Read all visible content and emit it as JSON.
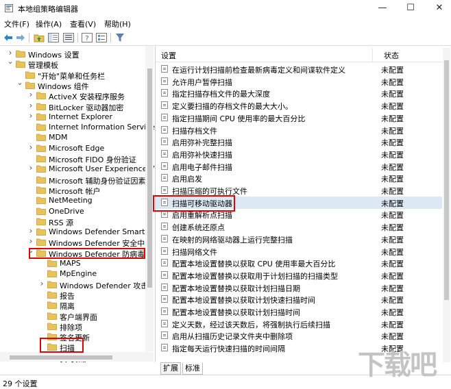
{
  "window": {
    "title": "本地组策略编辑器",
    "controls": [
      "—",
      "☐",
      "✕"
    ]
  },
  "menu": [
    "文件(F)",
    "操作(A)",
    "查看(V)",
    "帮助(H)"
  ],
  "tree": [
    {
      "label": "Windows 设置",
      "arrow": ">",
      "indent": 0
    },
    {
      "label": "管理模板",
      "arrow": "v",
      "indent": 0
    },
    {
      "label": "\"开始\"菜单和任务栏",
      "arrow": "",
      "indent": 1
    },
    {
      "label": "Windows 组件",
      "arrow": "v",
      "indent": 1
    },
    {
      "label": "ActiveX 安装程序服务",
      "arrow": ">",
      "indent": 2
    },
    {
      "label": "BitLocker 驱动器加密",
      "arrow": ">",
      "indent": 2
    },
    {
      "label": "Internet Explorer",
      "arrow": ">",
      "indent": 2
    },
    {
      "label": "Internet Information Service",
      "arrow": "",
      "indent": 2
    },
    {
      "label": "MDM",
      "arrow": "",
      "indent": 2
    },
    {
      "label": "Microsoft Edge",
      "arrow": ">",
      "indent": 2
    },
    {
      "label": "Microsoft FIDO 身份验证",
      "arrow": "",
      "indent": 2
    },
    {
      "label": "Microsoft User Experience V",
      "arrow": ">",
      "indent": 2
    },
    {
      "label": "Microsoft 辅助身份验证因素",
      "arrow": "",
      "indent": 2
    },
    {
      "label": "Microsoft 帐户",
      "arrow": "",
      "indent": 2
    },
    {
      "label": "NetMeeting",
      "arrow": "",
      "indent": 2
    },
    {
      "label": "OneDrive",
      "arrow": "",
      "indent": 2
    },
    {
      "label": "RSS 源",
      "arrow": "",
      "indent": 2
    },
    {
      "label": "Windows Defender SmartSc",
      "arrow": ">",
      "indent": 2
    },
    {
      "label": "Windows Defender 安全中心",
      "arrow": ">",
      "indent": 2
    },
    {
      "label": "Windows Defender 防病毒程",
      "arrow": "v",
      "indent": 2
    },
    {
      "label": "MAPS",
      "arrow": "",
      "indent": 3
    },
    {
      "label": "MpEngine",
      "arrow": "",
      "indent": 3
    },
    {
      "label": "Windows Defender 攻击",
      "arrow": ">",
      "indent": 3
    },
    {
      "label": "报告",
      "arrow": "",
      "indent": 3
    },
    {
      "label": "隔离",
      "arrow": "",
      "indent": 3
    },
    {
      "label": "客户端界面",
      "arrow": "",
      "indent": 3
    },
    {
      "label": "排除项",
      "arrow": "",
      "indent": 3
    },
    {
      "label": "签名更新",
      "arrow": "",
      "indent": 3
    },
    {
      "label": "扫描",
      "arrow": "",
      "indent": 3
    },
    {
      "label": "实时保护",
      "arrow": "",
      "indent": 3
    }
  ],
  "list": {
    "header": {
      "setting": "设置",
      "state": "状态"
    },
    "rows": [
      {
        "name": "在运行计划扫描前检查最新病毒定义和间谍软件定义",
        "state": "未配置"
      },
      {
        "name": "允许用户暂停扫描",
        "state": "未配置"
      },
      {
        "name": "指定扫描存档文件的最大深度",
        "state": "未配置"
      },
      {
        "name": "定义要扫描的存档文件的最大大小。",
        "state": "未配置"
      },
      {
        "name": "指定扫描期间 CPU 使用率的最大百分比",
        "state": "未配置"
      },
      {
        "name": "扫描存档文件",
        "state": "未配置"
      },
      {
        "name": "启用弥补完整扫描",
        "state": "未配置"
      },
      {
        "name": "启用弥补快速扫描",
        "state": "未配置"
      },
      {
        "name": "启用电子邮件扫描",
        "state": "未配置"
      },
      {
        "name": "启用启发",
        "state": "未配置"
      },
      {
        "name": "扫描压缩的可执行文件",
        "state": "未配置"
      },
      {
        "name": "扫描可移动驱动器",
        "state": "未配置"
      },
      {
        "name": "启用重解析点扫描",
        "state": "未配置"
      },
      {
        "name": "创建系统还原点",
        "state": "未配置"
      },
      {
        "name": "在映射的网络驱动器上运行完整扫描",
        "state": "未配置"
      },
      {
        "name": "扫描网络文件",
        "state": "未配置"
      },
      {
        "name": "配置本地设置替换以获取 CPU 使用率最大百分比",
        "state": "未配置"
      },
      {
        "name": "配置本地设置替换以获取用于计划扫描的扫描类型",
        "state": "未配置"
      },
      {
        "name": "配置本地设置替换以获取计划扫描日期",
        "state": "未配置"
      },
      {
        "name": "配置本地设置替换以获取计划快速扫描时间",
        "state": "未配置"
      },
      {
        "name": "配置本地设置替换以获取计划扫描时间",
        "state": "未配置"
      },
      {
        "name": "定义天数，经过该天数后，将强制执行后续扫描",
        "state": "未配置"
      },
      {
        "name": "启用从扫描历史记录文件夹中删除项",
        "state": "未配置"
      },
      {
        "name": "指定每天运行快速扫描的时间间隔",
        "state": "未配置"
      }
    ]
  },
  "tabs": [
    "扩展",
    "标准"
  ],
  "statusbar": {
    "text": "29 个设置"
  },
  "watermark": {
    "text": "下载吧",
    "sub": "www.xiazaiba.com"
  },
  "colors": {
    "highlight": "#e00000",
    "folder": "#e9c25a",
    "selected_row": "#dde8f5"
  }
}
